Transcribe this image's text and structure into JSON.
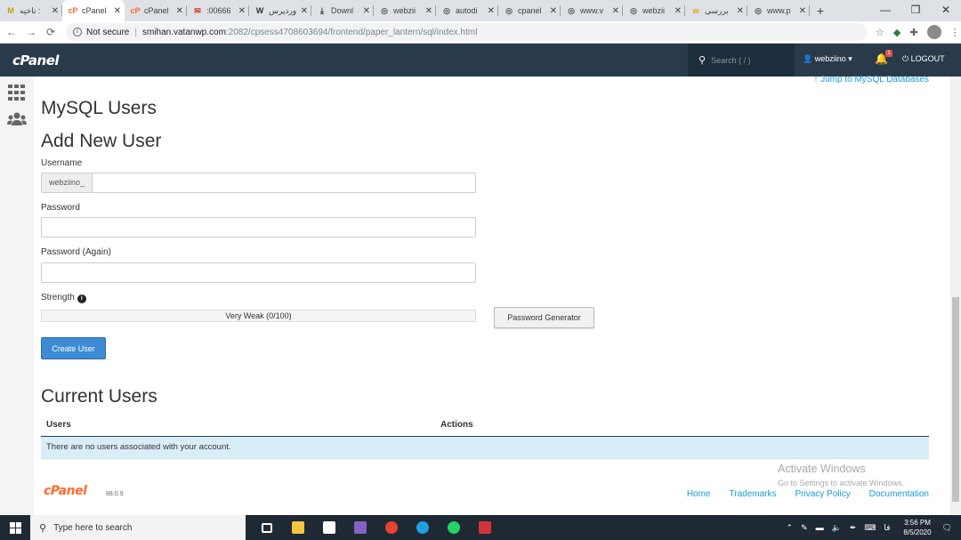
{
  "browser": {
    "tabs": [
      {
        "label": "تاخیه :",
        "favicon": "gmail-icon",
        "color": "#c5a100",
        "glyph": "M"
      },
      {
        "label": "cPanel",
        "favicon": "cpanel-icon",
        "color": "#ff6c2c",
        "glyph": "cP",
        "active": true
      },
      {
        "label": "cPanel",
        "favicon": "cpanel-icon",
        "color": "#ff6c2c",
        "glyph": "cP"
      },
      {
        "label": ":00666",
        "favicon": "mail-icon",
        "color": "#d93025",
        "glyph": "✉"
      },
      {
        "label": "وردپرس",
        "favicon": "wordpress-icon",
        "color": "#333333",
        "glyph": "W"
      },
      {
        "label": "Downl",
        "favicon": "download-icon",
        "color": "#333333",
        "glyph": "⤓"
      },
      {
        "label": "webzii",
        "favicon": "globe-icon",
        "color": "#555555",
        "glyph": "◎"
      },
      {
        "label": "autodi",
        "favicon": "globe-icon",
        "color": "#555555",
        "glyph": "◎"
      },
      {
        "label": "cpanel",
        "favicon": "globe-icon",
        "color": "#555555",
        "glyph": "◎"
      },
      {
        "label": "www.v",
        "favicon": "globe-icon",
        "color": "#555555",
        "glyph": "◎"
      },
      {
        "label": "webzii",
        "favicon": "globe-icon",
        "color": "#555555",
        "glyph": "◎"
      },
      {
        "label": "بررسی",
        "favicon": "wix-icon",
        "color": "#e8a100",
        "glyph": "w"
      },
      {
        "label": "www.p",
        "favicon": "globe-icon",
        "color": "#555555",
        "glyph": "◎"
      }
    ],
    "new_tab": "+",
    "address": {
      "security": "Not secure",
      "host": "smihan.vatanwp.com",
      "path": ":2082/cpsess4708603694/frontend/paper_lantern/sql/index.html"
    }
  },
  "cpanel_header": {
    "logo": "cPanel",
    "search_placeholder": "Search ( / )",
    "username": "webziino",
    "notification_count": "1",
    "logout": "LOGOUT"
  },
  "page": {
    "jump_link": "Jump to MySQL Databases",
    "title": "MySQL Users",
    "add_section": "Add New User",
    "username_label": "Username",
    "username_prefix": "webziino_",
    "username_value": "",
    "password_label": "Password",
    "password_again_label": "Password (Again)",
    "strength_label": "Strength",
    "strength_text": "Very Weak (0/100)",
    "strength_score": 0,
    "password_generator": "Password Generator",
    "create_user": "Create User",
    "current_section": "Current Users",
    "table": {
      "columns": [
        "Users",
        "Actions"
      ],
      "empty_message": "There are no users associated with your account."
    }
  },
  "windows_watermark": {
    "line1": "Activate Windows",
    "line2": "Go to Settings to activate Windows."
  },
  "footer": {
    "logo": "cPanel",
    "version": "88.0.9",
    "links": [
      "Home",
      "Trademarks",
      "Privacy Policy",
      "Documentation"
    ]
  },
  "taskbar": {
    "search_placeholder": "Type here to search",
    "lang": "فا",
    "time": "3:56 PM",
    "date": "8/5/2020",
    "apps": [
      {
        "name": "task-view-icon",
        "color": "#ffffff"
      },
      {
        "name": "file-explorer-icon",
        "color": "#f4c542"
      },
      {
        "name": "store-icon",
        "color": "#ffffff"
      },
      {
        "name": "visual-studio-icon",
        "color": "#8661c5"
      },
      {
        "name": "chrome-icon",
        "color": "#e94235"
      },
      {
        "name": "edge-icon",
        "color": "#1fa0e3"
      },
      {
        "name": "whatsapp-icon",
        "color": "#25d366"
      },
      {
        "name": "app-red-icon",
        "color": "#d13438"
      }
    ]
  }
}
